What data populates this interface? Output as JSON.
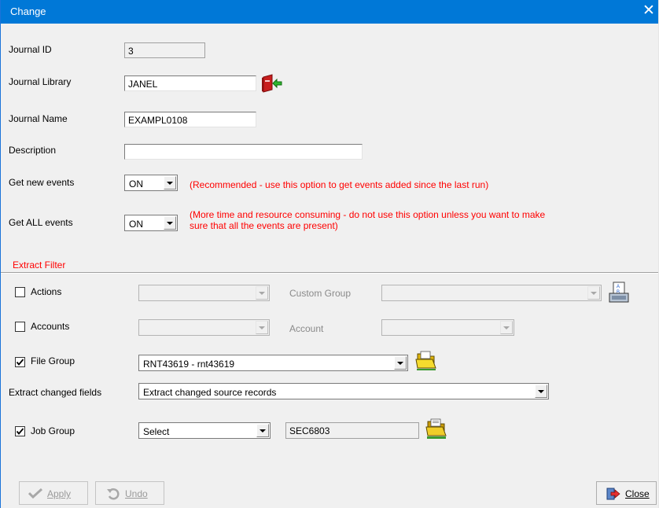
{
  "window": {
    "title": "Change",
    "close_glyph": "✕"
  },
  "fields": {
    "journal_id_label": "Journal ID",
    "journal_id_value": "3",
    "journal_library_label": "Journal Library",
    "journal_library_value": "JANEL",
    "journal_name_label": "Journal Name",
    "journal_name_value": "EXAMPL0108",
    "description_label": "Description",
    "description_value": "",
    "get_new_events_label": "Get new events",
    "get_new_events_value": "ON",
    "get_new_events_note": "(Recommended - use this option to get events added since the last run)",
    "get_all_events_label": "Get ALL events",
    "get_all_events_value": "ON",
    "get_all_events_note_line1": "(More time and resource consuming - do not use this option unless you want to make",
    "get_all_events_note_line2": "sure that all the events are present)"
  },
  "filter": {
    "section_title": "Extract Filter",
    "actions_label": "Actions",
    "actions_checked": false,
    "actions_value": "",
    "custom_group_label": "Custom Group",
    "custom_group_value": "",
    "accounts_label": "Accounts",
    "accounts_checked": false,
    "accounts_value": "",
    "account_label": "Account",
    "account_value": "",
    "file_group_label": "File Group",
    "file_group_checked": true,
    "file_group_value": "RNT43619 - rnt43619",
    "extract_changed_fields_label": "Extract changed fields",
    "extract_changed_fields_value": "Extract changed source records",
    "job_group_label": "Job Group",
    "job_group_checked": true,
    "job_group_select_value": "Select",
    "job_group_value": "SEC6803"
  },
  "buttons": {
    "apply_label": "Apply",
    "undo_label": "Undo",
    "close_label": "Close"
  },
  "colors": {
    "titlebar": "#0078d7",
    "note_red": "#ff0000",
    "section_red": "#ff0000"
  }
}
